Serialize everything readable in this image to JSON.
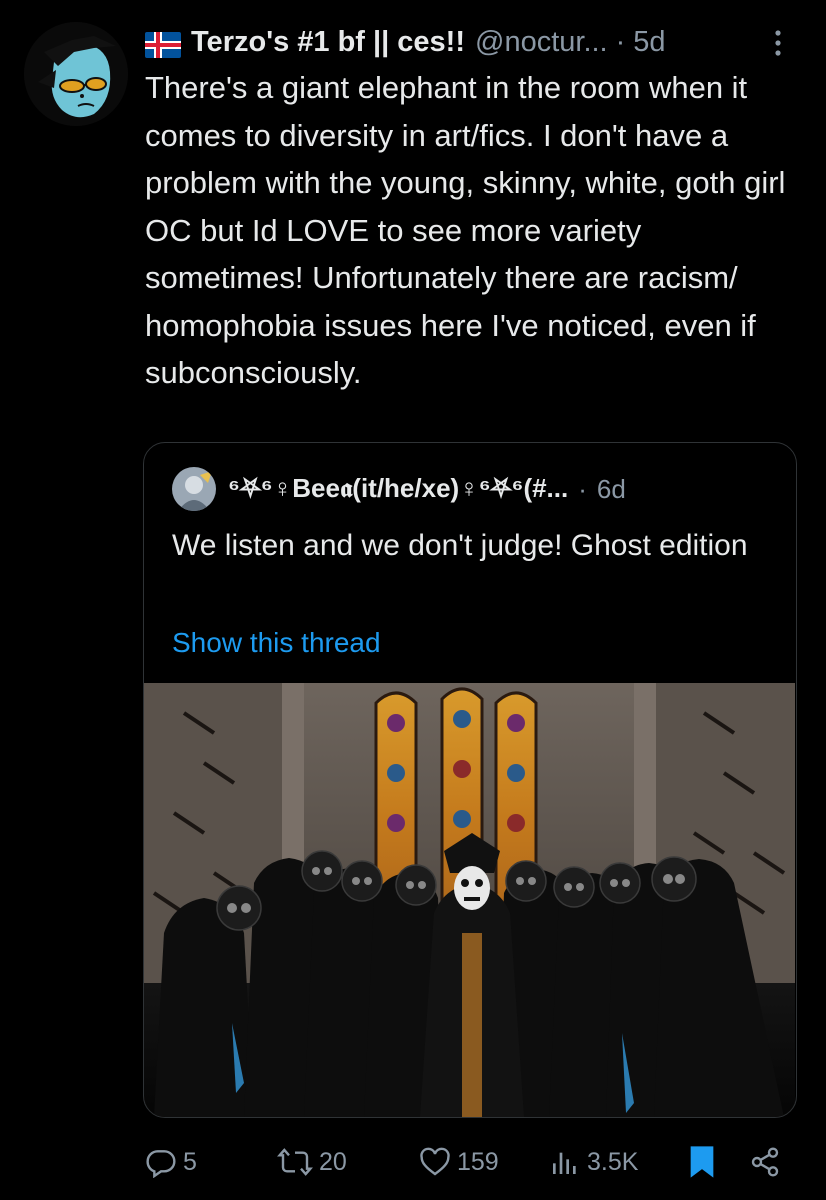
{
  "tweet": {
    "display_name": "Terzo's #1 bf || ces!!",
    "handle": "@noctur...",
    "separator": "·",
    "time": "5d",
    "flag_icon": "iceland-flag-icon",
    "text": "There's a giant elephant in the room when it comes to diversity in art/fics. I don't have a problem with the young, skinny, white, goth girl OC but Id LOVE to see more variety sometimes! Unfortunately there are racism/ homophobia issues here I've noticed, even if subconsciously."
  },
  "quoted": {
    "display_name": "⁶⛧⁶♀Bee𝖆(it/he/xe)♀⁶⛧⁶(#...",
    "separator": "·",
    "time": "6d",
    "text": "We listen and we don't judge! Ghost edition",
    "link": "Show this thread",
    "image_icon": "band-photo"
  },
  "actions": {
    "replies": "5",
    "retweets": "20",
    "likes": "159",
    "views": "3.5K"
  },
  "colors": {
    "background": "#000000",
    "text": "#e7e9ea",
    "secondary": "#8b98a5",
    "accent": "#1d9bf0"
  }
}
